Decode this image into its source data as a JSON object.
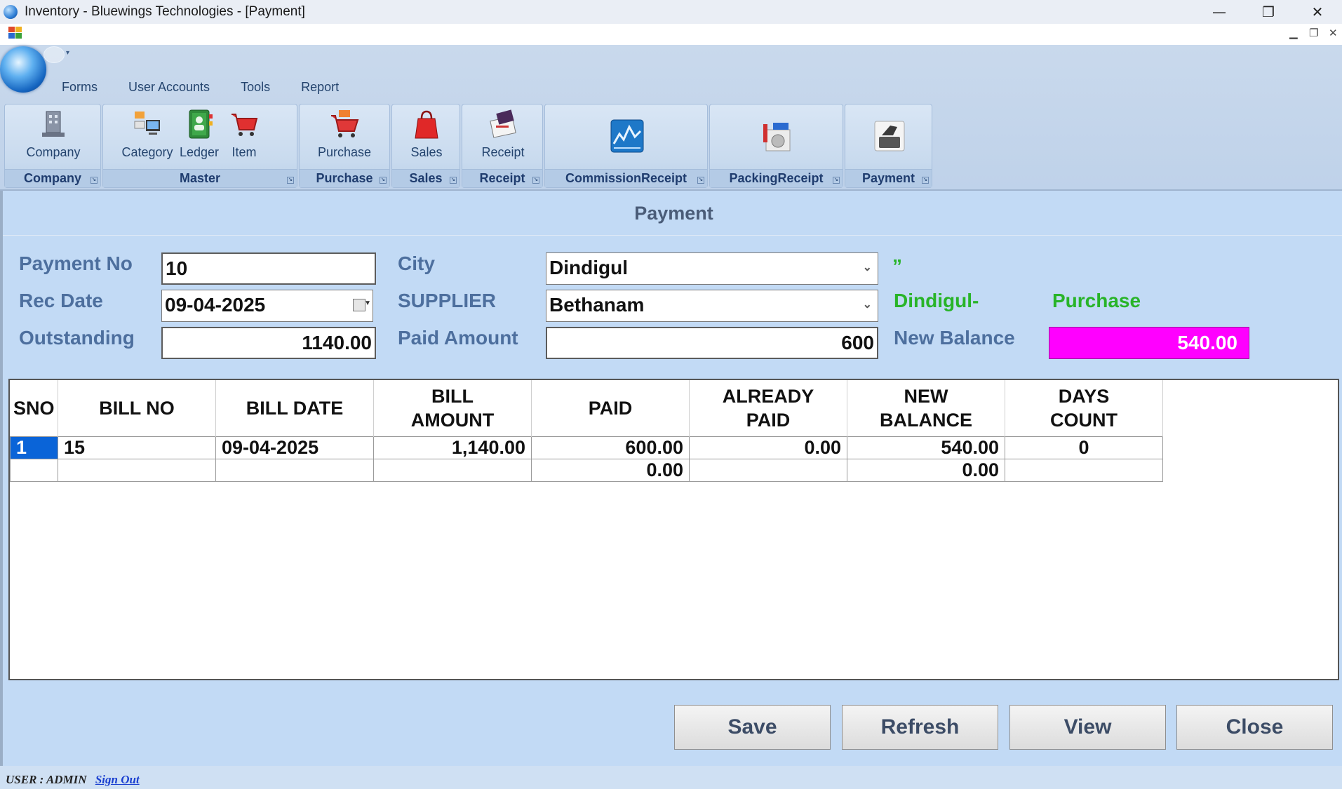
{
  "window": {
    "title": "Inventory - Bluewings Technologies - [Payment]",
    "controls": {
      "minimize": "—",
      "maximize": "❐",
      "close": "✕"
    }
  },
  "mdi": {
    "minimize": "▁",
    "restore": "❐",
    "close": "✕"
  },
  "menu": [
    "Forms",
    "User Accounts",
    "Tools",
    "Report"
  ],
  "ribbon": {
    "groups": {
      "company": "Company",
      "master": "Master",
      "purchase": "Purchase",
      "sales": "Sales",
      "receipt": "Receipt",
      "commission": "CommissionReceipt",
      "packing": "PackingReceipt",
      "payment": "Payment"
    },
    "buttons": {
      "company": "Company",
      "category": "Category",
      "ledger": "Ledger",
      "item": "Item",
      "purchase": "Purchase",
      "sales": "Sales",
      "receipt": "Receipt"
    },
    "icons": {
      "company": "company-building-icon",
      "category": "category-icon",
      "ledger": "ledger-book-icon",
      "item": "shopping-cart-icon",
      "purchase": "purchase-cart-icon",
      "sales": "shopping-bag-icon",
      "receipt": "receipt-icon",
      "commission": "commission-chart-icon",
      "packing": "packing-receipt-icon",
      "payment": "payment-hand-card-icon"
    }
  },
  "form": {
    "title": "Payment",
    "labels": {
      "payment_no": "Payment No",
      "rec_date": "Rec Date",
      "outstanding": "Outstanding",
      "city": "City",
      "supplier": "SUPPLIER",
      "paid_amount": "Paid Amount",
      "new_balance": "New Balance"
    },
    "values": {
      "payment_no": "10",
      "rec_date": "09-04-2025",
      "outstanding": "1140.00",
      "city": "Dindigul",
      "supplier": "Bethanam",
      "paid_amount": "600",
      "new_balance": "540.00"
    },
    "info": {
      "quote_mark": "”",
      "supplier_city": "Dindigul-",
      "type": "Purchase"
    }
  },
  "grid": {
    "columns": [
      "SNO",
      "BILL NO",
      "BILL DATE",
      "BILL\nAMOUNT",
      "PAID",
      "ALREADY\nPAID",
      "NEW\nBALANCE",
      "DAYS\nCOUNT"
    ],
    "rows": [
      [
        "1",
        "15",
        "09-04-2025",
        "1,140.00",
        "600.00",
        "0.00",
        "540.00",
        "0"
      ],
      [
        "",
        "",
        "",
        "",
        "0.00",
        "",
        "0.00",
        ""
      ]
    ]
  },
  "buttons": {
    "save": "Save",
    "refresh": "Refresh",
    "view": "View",
    "close": "Close"
  },
  "status": {
    "user": "USER :  ADMIN",
    "signout": "Sign Out"
  },
  "colors": {
    "form_bg": "#c2daf5",
    "new_balance_bg": "#ff00ff",
    "info_green": "#28b428",
    "selected_cell": "#0a64d8"
  }
}
